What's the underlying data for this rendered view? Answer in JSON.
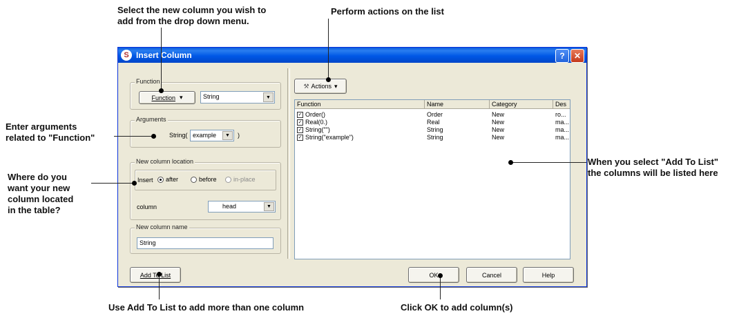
{
  "annotations": {
    "top_left_line1": "Select the new column you wish to",
    "top_left_line2": "add from the drop down menu.",
    "top_right": "Perform actions on the list",
    "args_line1": "Enter arguments",
    "args_line2": "related to \"Function\"",
    "loc_line1": "Where do you",
    "loc_line2": "want your new",
    "loc_line3": "column located",
    "loc_line4": "in the table?",
    "list_line1": "When you select \"Add To List\"",
    "list_line2": "the columns will be listed here",
    "bottom_left": "Use Add To List to add more than one column",
    "bottom_right": "Click OK to add column(s)"
  },
  "dialog": {
    "title": "Insert Column",
    "help_glyph": "?",
    "close_glyph": "✕",
    "app_icon_glyph": "S",
    "function_group": {
      "legend": "Function",
      "button_label": "Function",
      "button_arrow": "▾",
      "selected": "String",
      "combo_arrow": "▼"
    },
    "arguments_group": {
      "legend": "Arguments",
      "prefix": "String(",
      "value": "example",
      "combo_arrow": "▼",
      "suffix": ")"
    },
    "location_group": {
      "legend": "New column location",
      "insert_label": "Insert",
      "options": [
        "after",
        "before",
        "in-place"
      ],
      "selected_option": "after",
      "column_label": "column",
      "column_value": "head",
      "combo_arrow": "▼"
    },
    "name_group": {
      "legend": "New column name",
      "value": "String"
    },
    "actions_button": {
      "label": "Actions",
      "arrow": "▾",
      "icon": "wrench-icon"
    },
    "list": {
      "columns": [
        "Function",
        "Name",
        "Category",
        "Des"
      ],
      "rows": [
        {
          "function": "Order()",
          "name": "Order",
          "category": "New",
          "des": "ro..."
        },
        {
          "function": "Real(0.)",
          "name": "Real",
          "category": "New",
          "des": "ma..."
        },
        {
          "function": "String(\"\")",
          "name": "String",
          "category": "New",
          "des": "ma..."
        },
        {
          "function": "String(\"example\")",
          "name": "String",
          "category": "New",
          "des": "ma..."
        }
      ]
    },
    "buttons": {
      "add_to_list": "Add To List",
      "ok": "OK",
      "cancel": "Cancel",
      "help": "Help"
    }
  }
}
